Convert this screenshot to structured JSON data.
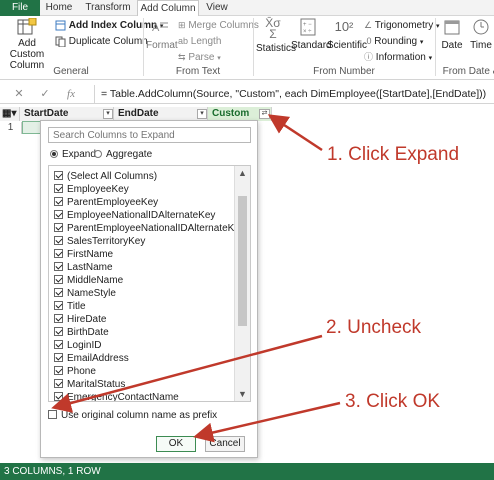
{
  "ribbon_tabs": [
    {
      "label": "File"
    },
    {
      "label": "Home"
    },
    {
      "label": "Transform"
    },
    {
      "label": "Add Column"
    },
    {
      "label": "View"
    }
  ],
  "ribbon": {
    "add_custom_column": "Add Custom Column",
    "add_index_column": "Add Index Column",
    "duplicate_column": "Duplicate Column",
    "general_group": "General",
    "format": "Format",
    "merge_columns": "Merge Columns",
    "length": "Length",
    "parse": "Parse",
    "from_text_group": "From Text",
    "statistics": "Statistics",
    "standard": "Standard",
    "scientific": "Scientific",
    "trigonometry": "Trigonometry",
    "rounding": "Rounding",
    "information": "Information",
    "from_number_group": "From Number",
    "date": "Date",
    "time": "Time",
    "from_date_group": "From Date &"
  },
  "formula_bar": {
    "formula": "= Table.AddColumn(Source, \"Custom\", each DimEmployee([StartDate],[EndDate]))"
  },
  "grid": {
    "columns": [
      "StartDate",
      "EndDate",
      "Custom"
    ],
    "row_number": "1"
  },
  "expand_dialog": {
    "search_placeholder": "Search Columns to Expand",
    "expand_label": "Expand",
    "aggregate_label": "Aggregate",
    "items": [
      "(Select All Columns)",
      "EmployeeKey",
      "ParentEmployeeKey",
      "EmployeeNationalIDAlternateKey",
      "ParentEmployeeNationalIDAlternateKey",
      "SalesTerritoryKey",
      "FirstName",
      "LastName",
      "MiddleName",
      "NameStyle",
      "Title",
      "HireDate",
      "BirthDate",
      "LoginID",
      "EmailAddress",
      "Phone",
      "MaritalStatus",
      "EmergencyContactName"
    ],
    "prefix_label": "Use original column name as prefix",
    "ok_label": "OK",
    "cancel_label": "Cancel"
  },
  "annotations": {
    "step1": "1. Click Expand",
    "step2": "2. Uncheck",
    "step3": "3. Click OK"
  },
  "annotation_color": "#c0392b",
  "accent_color": "#217346",
  "status_bar": {
    "text": "3 COLUMNS, 1 ROW"
  }
}
